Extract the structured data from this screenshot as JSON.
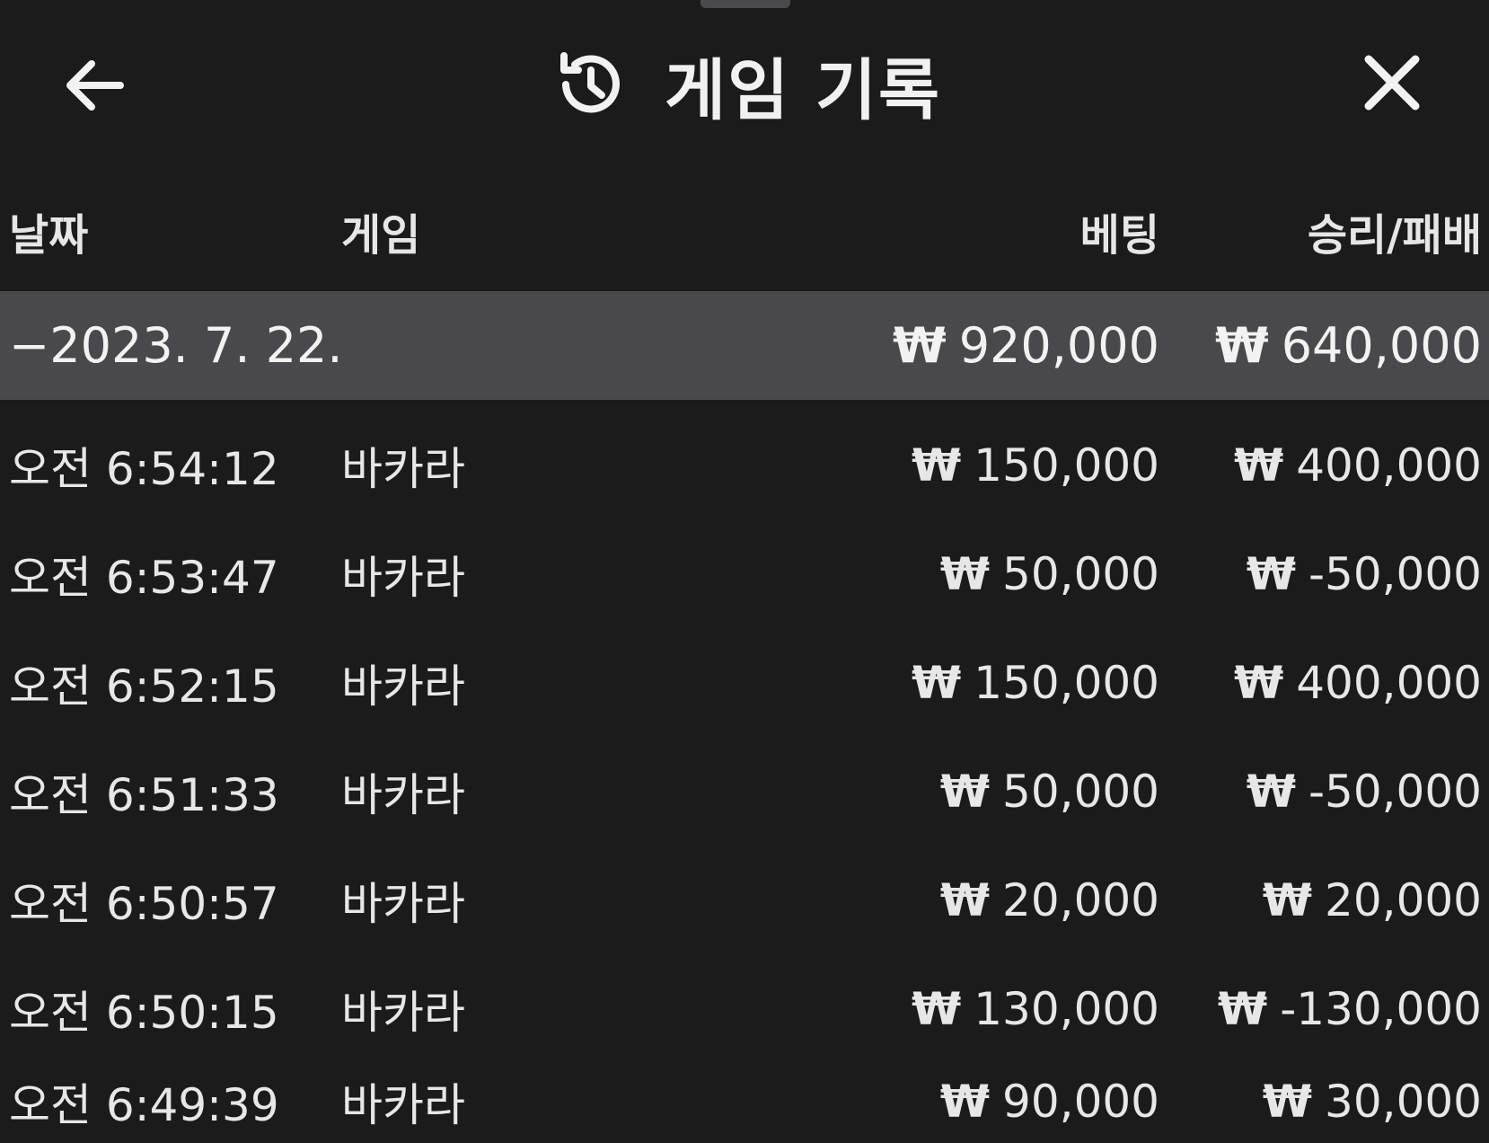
{
  "header": {
    "title": "게임 기록",
    "back_icon": "arrow-left-icon",
    "history_icon": "history-clock-icon",
    "close_icon": "close-icon"
  },
  "table": {
    "columns": {
      "date": "날짜",
      "game": "게임",
      "bet": "베팅",
      "result": "승리/패배"
    },
    "currency_symbol": "₩",
    "date_group": {
      "label": "−2023. 7. 22.",
      "bet_total": "920,000",
      "result_total": "640,000"
    },
    "rows": [
      {
        "time": "오전 6:54:12",
        "game": "바카라",
        "bet": "150,000",
        "result": "400,000"
      },
      {
        "time": "오전 6:53:47",
        "game": "바카라",
        "bet": "50,000",
        "result": "-50,000"
      },
      {
        "time": "오전 6:52:15",
        "game": "바카라",
        "bet": "150,000",
        "result": "400,000"
      },
      {
        "time": "오전 6:51:33",
        "game": "바카라",
        "bet": "50,000",
        "result": "-50,000"
      },
      {
        "time": "오전 6:50:57",
        "game": "바카라",
        "bet": "20,000",
        "result": "20,000"
      },
      {
        "time": "오전 6:50:15",
        "game": "바카라",
        "bet": "130,000",
        "result": "-130,000"
      },
      {
        "time": "오전 6:49:39",
        "game": "바카라",
        "bet": "90,000",
        "result": "30,000"
      }
    ]
  },
  "colors": {
    "background": "#1b1b1c",
    "date_row": "#49494b",
    "text": "#e7e7e8"
  }
}
